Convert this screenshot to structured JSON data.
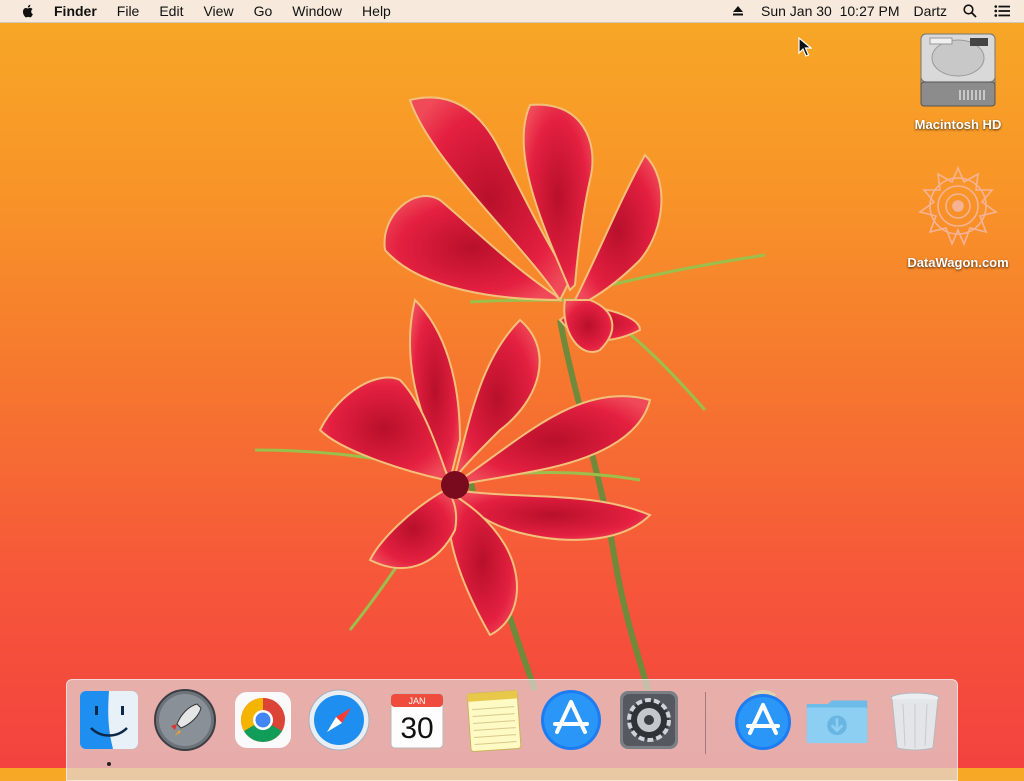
{
  "menubar": {
    "app_name": "Finder",
    "menus": [
      "File",
      "Edit",
      "View",
      "Go",
      "Window",
      "Help"
    ],
    "clock": "Sun Jan 30  10:27 PM",
    "user": "Dartz",
    "icons": [
      "apple-icon",
      "eject-icon",
      "spotlight-search-icon",
      "notification-center-icon"
    ]
  },
  "desktop": {
    "icons": [
      {
        "label": "Macintosh HD",
        "icon": "hard-drive-icon"
      },
      {
        "label": "DataWagon.com",
        "icon": "mandala-disk-icon"
      }
    ]
  },
  "dock": {
    "calendar": {
      "month": "JAN",
      "day": "30"
    },
    "apps": [
      "finder-icon",
      "launchpad-icon",
      "chrome-icon",
      "safari-icon",
      "calendar-icon",
      "notes-icon",
      "app-store-icon",
      "system-preferences-icon",
      "app-store-download-icon",
      "downloads-folder-icon",
      "trash-icon"
    ]
  },
  "colors": {
    "wallpaper_top": "#f7a926",
    "wallpaper_bottom": "#f3423f",
    "flower": "#e8203a"
  }
}
